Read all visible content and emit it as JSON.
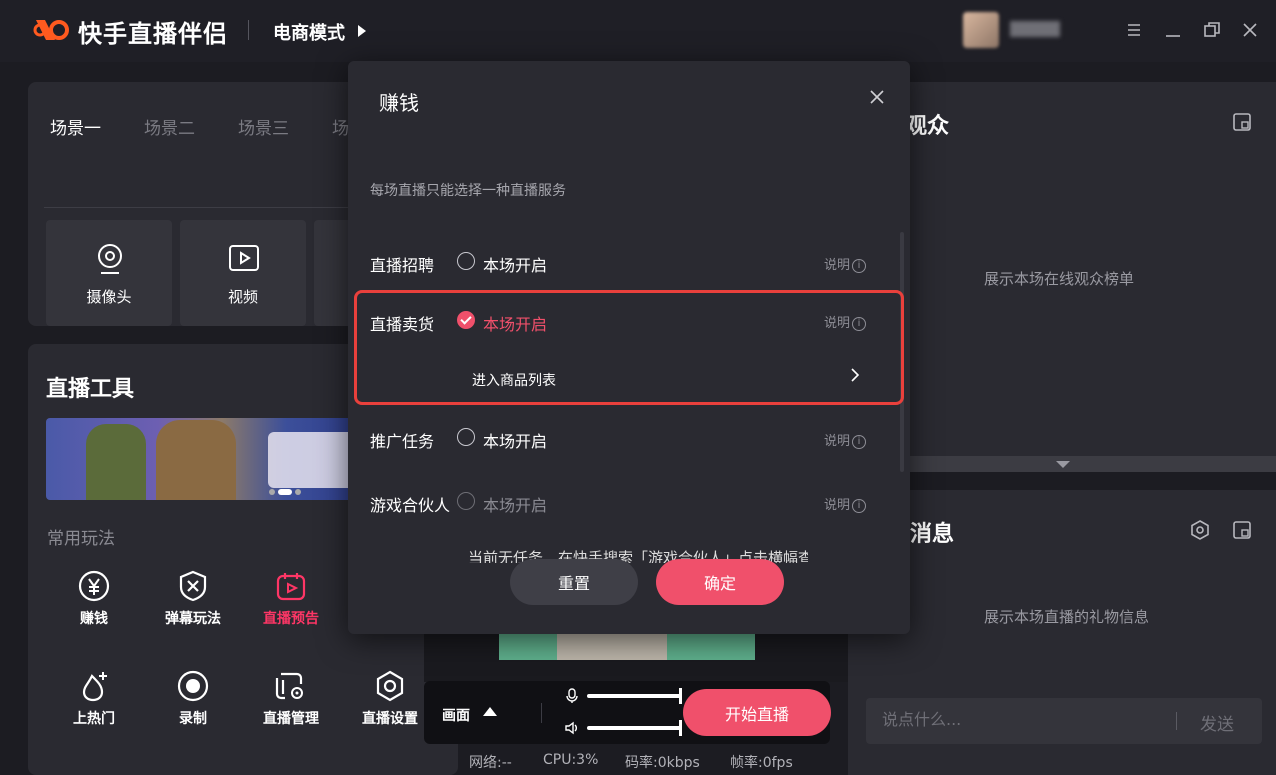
{
  "app": {
    "name": "快手直播伴侣",
    "mode": "电商模式"
  },
  "scenes": {
    "tabs": [
      "场景一",
      "场景二",
      "场景三",
      "场"
    ],
    "sources": [
      {
        "label": "摄像头",
        "icon": "webcam-icon"
      },
      {
        "label": "视频",
        "icon": "video-icon"
      }
    ]
  },
  "tools": {
    "title": "直播工具",
    "common_label": "常用玩法",
    "items": [
      {
        "label": "赚钱",
        "icon": "yen-coin-icon"
      },
      {
        "label": "弹幕玩法",
        "icon": "barrage-shield-icon"
      },
      {
        "label": "直播预告",
        "icon": "calendar-play-icon"
      },
      {
        "label": "上热门",
        "icon": "flame-plus-icon"
      },
      {
        "label": "录制",
        "icon": "record-icon"
      },
      {
        "label": "直播管理",
        "icon": "manage-gear-icon"
      },
      {
        "label": "直播设置",
        "icon": "settings-hexagon-icon"
      }
    ]
  },
  "audience": {
    "title_fragment": "观众",
    "empty": "展示本场在线观众榜单"
  },
  "messages": {
    "title_fragment": "消息",
    "empty": "展示本场直播的礼物信息",
    "input_placeholder": "说点什么...",
    "send": "发送"
  },
  "controls": {
    "canvas_label": "画面",
    "start_label": "开始直播",
    "stats": {
      "network": "网络:--",
      "cpu": "CPU:3%",
      "bitrate": "码率:0kbps",
      "fps": "帧率:0fps"
    }
  },
  "dialog": {
    "title": "赚钱",
    "hint": "每场直播只能选择一种直播服务",
    "options": [
      {
        "label": "直播招聘",
        "option": "本场开启",
        "checked": false,
        "explain": "说明"
      },
      {
        "label": "直播卖货",
        "option": "本场开启",
        "checked": true,
        "explain": "说明",
        "sub_link": "进入商品列表"
      },
      {
        "label": "推广任务",
        "option": "本场开启",
        "checked": false,
        "explain": "说明"
      },
      {
        "label": "游戏合伙人",
        "option": "本场开启",
        "checked": false,
        "disabled": true,
        "explain": "说明"
      }
    ],
    "partial_note": "当前无任务，在快手搜索「游戏合伙人」点击横幅查看",
    "reset_label": "重置",
    "confirm_label": "确定"
  },
  "colors": {
    "accent": "#f0506b",
    "highlight_border": "#e9403c",
    "background": "#1c1c22",
    "panel": "#2a2a31"
  }
}
